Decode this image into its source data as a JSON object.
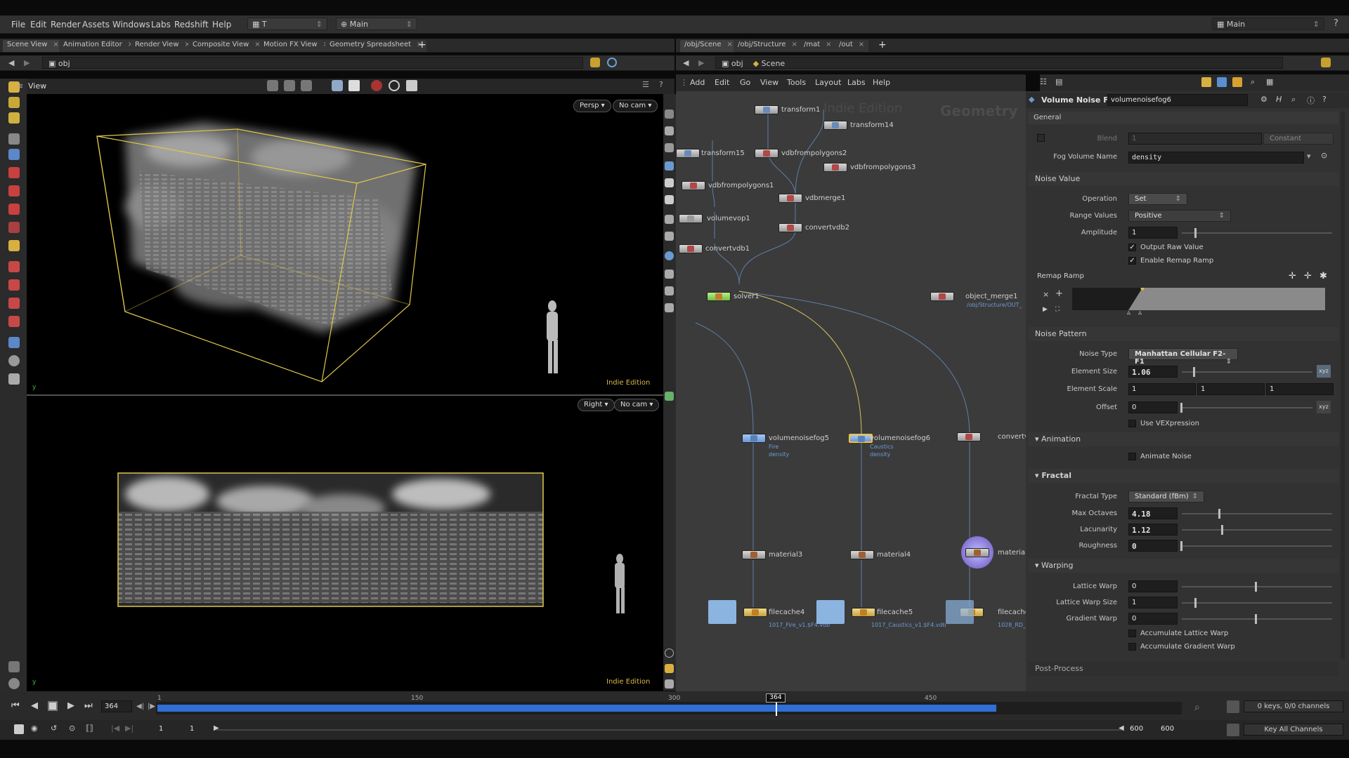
{
  "menu": {
    "items": [
      "File",
      "Edit",
      "Render",
      "Assets",
      "Windows",
      "Labs",
      "Redshift",
      "Help"
    ],
    "desktop": "T",
    "context": "Main",
    "desktop_right": "Main"
  },
  "left_tabs": [
    "Scene View",
    "Animation Editor",
    "Render View",
    "Composite View",
    "Motion FX View",
    "Geometry Spreadsheet"
  ],
  "left_path": "obj",
  "view_title": "View",
  "viewport_top": {
    "camera_mode": "Persp",
    "camera": "No cam",
    "badge": "Indie Edition"
  },
  "viewport_bottom": {
    "camera_mode": "Right",
    "camera": "No cam",
    "badge": "Indie Edition"
  },
  "right_tabs": [
    "/obj/Scene",
    "/obj/Structure",
    "/mat",
    "/out"
  ],
  "net_path": {
    "level": "obj",
    "node": "Scene"
  },
  "net_menu": [
    "Add",
    "Edit",
    "Go",
    "View",
    "Tools",
    "Layout",
    "Labs",
    "Help"
  ],
  "net_watermark": {
    "edition": "Indie Edition",
    "context": "Geometry"
  },
  "nodes": {
    "transform1": "transform1",
    "transform14": "transform14",
    "transform15": "transform15",
    "vdbfrompolygons2": "vdbfrompolygons2",
    "vdbfrompolygons3": "vdbfrompolygons3",
    "vdbfrompolygons1": "vdbfrompolygons1",
    "vdbmerge1": "vdbmerge1",
    "volumevop1": "volumevop1",
    "convertvdb2": "convertvdb2",
    "convertvdb1": "convertvdb1",
    "solver1": "solver1",
    "object_merge1": "object_merge1",
    "object_merge1_path": "/obj/Structure/OUT_",
    "volumenoisefog5": "volumenoisefog5",
    "vnf5_sub1": "Fire",
    "vnf5_sub2": "density",
    "volumenoisefog6": "volumenoisefog6",
    "vnf6_sub1": "Caustics",
    "vnf6_sub2": "density",
    "convertv": "convertv",
    "material3": "material3",
    "material4": "material4",
    "material5": "materialS",
    "filecache4": "filecache4",
    "filecache4_file": "1017_Fire_v1.$F4.vdb",
    "filecache5": "filecache5",
    "filecache5_file": "1017_Caustics_v1.$F4.vdb",
    "filecache6": "filecache",
    "filecache6_file": "1028_RD_"
  },
  "params": {
    "node_type": "Volume Noise Fog",
    "node_name": "volumenoisefog6",
    "general": "General",
    "blend_label": "Blend",
    "blend_value": "1",
    "blend_mode": "Constant",
    "fog_volume_label": "Fog Volume Name",
    "fog_volume_value": "density",
    "noise_value": "Noise Value",
    "operation_label": "Operation",
    "operation_value": "Set",
    "range_label": "Range Values",
    "range_value": "Positive",
    "amplitude_label": "Amplitude",
    "amplitude_value": "1",
    "output_raw": "Output Raw Value",
    "enable_remap": "Enable Remap Ramp",
    "remap_label": "Remap Ramp",
    "noise_pattern": "Noise Pattern",
    "noise_type_label": "Noise Type",
    "noise_type_value": "Manhattan Cellular F2-F1",
    "element_size_label": "Element Size",
    "element_size_value": "1.06",
    "element_scale_label": "Element Scale",
    "element_scale_x": "1",
    "element_scale_y": "1",
    "element_scale_z": "1",
    "offset_label": "Offset",
    "offset_value": "0",
    "use_vex": "Use VEXpression",
    "animation": "Animation",
    "animate_noise": "Animate Noise",
    "fractal": "Fractal",
    "fractal_type_label": "Fractal Type",
    "fractal_type_value": "Standard (fBm)",
    "max_octaves_label": "Max Octaves",
    "max_octaves_value": "4.18",
    "lacunarity_label": "Lacunarity",
    "lacunarity_value": "1.12",
    "roughness_label": "Roughness",
    "roughness_value": "0",
    "warping": "Warping",
    "lattice_warp_label": "Lattice Warp",
    "lattice_warp_value": "0",
    "lattice_warp_size_label": "Lattice Warp Size",
    "lattice_warp_size_value": "1",
    "gradient_warp_label": "Gradient Warp",
    "gradient_warp_value": "0",
    "acc_lattice": "Accumulate Lattice Warp",
    "acc_gradient": "Accumulate Gradient Warp",
    "post_process": "Post-Process"
  },
  "timeline": {
    "current_frame": "364",
    "marker": "364",
    "ticks": [
      "1",
      "150",
      "300",
      "450"
    ],
    "start": "1",
    "start2": "1",
    "end": "600",
    "end2": "600",
    "keys": "0 keys, 0/0 channels",
    "key_all": "Key All Channels"
  },
  "colors": {
    "accent_yellow": "#d9b84a",
    "timeline_blue": "#2f6fd6",
    "solver_green": "#8fd85c",
    "node_selected": "#f0c040"
  }
}
